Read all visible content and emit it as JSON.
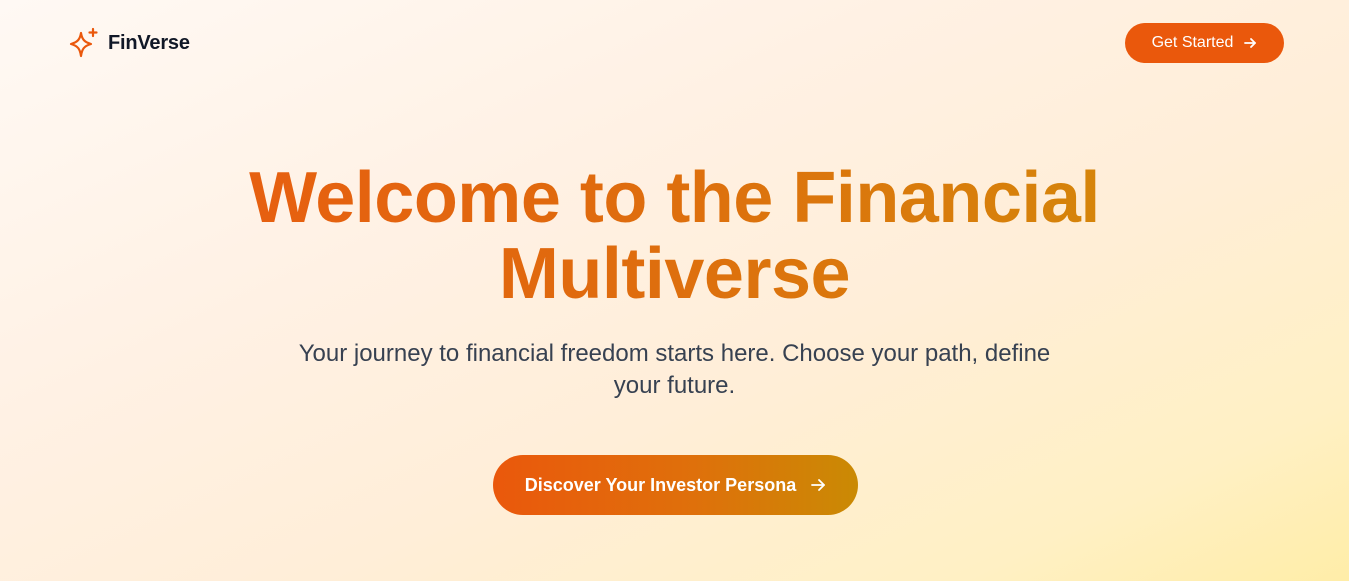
{
  "header": {
    "logo_text": "FinVerse",
    "logo_icon": "sparkles-icon",
    "cta_label": "Get Started",
    "cta_icon": "arrow-right-icon"
  },
  "hero": {
    "title": "Welcome to the Financial Multiverse",
    "subtitle": "Your journey to financial freedom starts here. Choose your path, define your future.",
    "cta_label": "Discover Your Investor Persona",
    "cta_icon": "arrow-right-icon"
  },
  "colors": {
    "accent": "#ea580c",
    "gradient_end": "#ca8a04",
    "text_dark": "#111827",
    "text_muted": "#374151"
  }
}
